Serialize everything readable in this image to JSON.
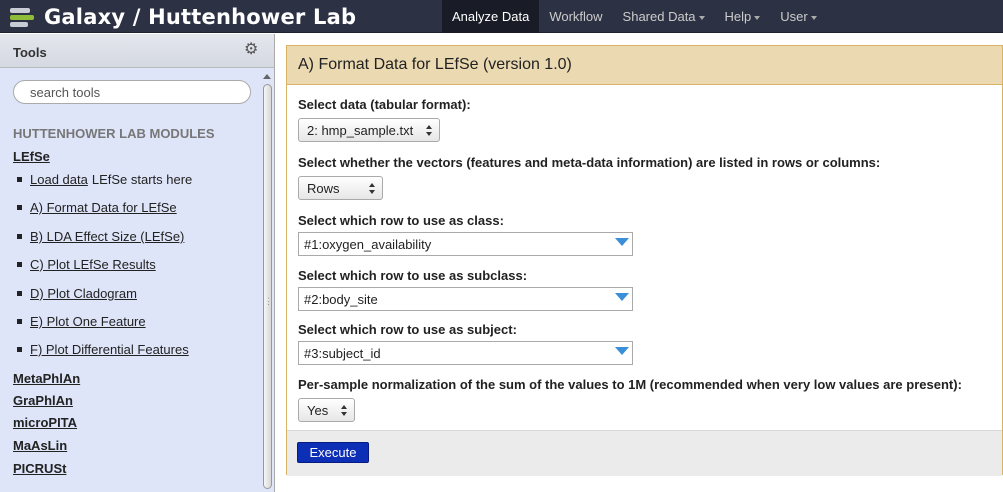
{
  "masthead": {
    "brand": "Galaxy / Huttenhower Lab",
    "nav": [
      {
        "label": "Analyze Data",
        "active": true,
        "dropdown": false
      },
      {
        "label": "Workflow",
        "active": false,
        "dropdown": false
      },
      {
        "label": "Shared Data",
        "active": false,
        "dropdown": true
      },
      {
        "label": "Help",
        "active": false,
        "dropdown": true
      },
      {
        "label": "User",
        "active": false,
        "dropdown": true
      }
    ]
  },
  "left_panel": {
    "title": "Tools",
    "search_placeholder": "search tools",
    "section_title": "HUTTENHOWER LAB MODULES",
    "section_link": "LEfSe",
    "tools": [
      {
        "label": "Load data",
        "extra": "LEfSe starts here"
      },
      {
        "label": "A) Format Data for LEfSe"
      },
      {
        "label": "B) LDA Effect Size (LEfSe)"
      },
      {
        "label": "C) Plot LEfSe Results"
      },
      {
        "label": "D) Plot Cladogram"
      },
      {
        "label": "E) Plot One Feature"
      },
      {
        "label": "F) Plot Differential Features"
      }
    ],
    "modules": [
      "MetaPhlAn",
      "GraPhlAn",
      "microPITA",
      "MaAsLin",
      "PICRUSt"
    ]
  },
  "tool_form": {
    "title": "A) Format Data for LEfSe (version 1.0)",
    "fields": [
      {
        "label": "Select data (tabular format):",
        "value": "2: hmp_sample.txt"
      },
      {
        "label": "Select whether the vectors (features and meta-data information) are listed in rows or columns:",
        "value": "Rows"
      },
      {
        "label": "Select which row to use as class:",
        "value": "#1:oxygen_availability"
      },
      {
        "label": "Select which row to use as subclass:",
        "value": "#2:body_site"
      },
      {
        "label": "Select which row to use as subject:",
        "value": "#3:subject_id"
      },
      {
        "label": "Per-sample normalization of the sum of the values to 1M (recommended when very low values are present):",
        "value": "Yes"
      }
    ],
    "execute_label": "Execute"
  },
  "colors": {
    "masthead_bg": "#2c3143",
    "left_panel_bg": "#dfe5f9",
    "form_title_bg": "#ebd9b2",
    "execute_bg": "#0d2fb5"
  }
}
